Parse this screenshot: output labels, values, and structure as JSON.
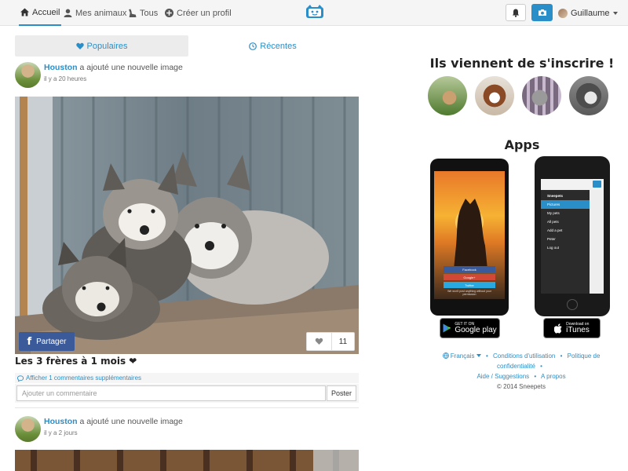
{
  "nav": {
    "items": [
      {
        "label": "Accueil",
        "icon": "home-icon",
        "active": true
      },
      {
        "label": "Mes animaux",
        "icon": "user-icon"
      },
      {
        "label": "Tous",
        "icon": "dog-icon"
      },
      {
        "label": "Créer un profil",
        "icon": "plus-circle-icon"
      }
    ],
    "user_name": "Guillaume"
  },
  "feed_tabs": [
    {
      "label": "Populaires",
      "icon": "heart-icon",
      "active": true
    },
    {
      "label": "Récentes",
      "icon": "clock-icon"
    }
  ],
  "posts": [
    {
      "author": "Houston",
      "action": " a ajouté une nouvelle image",
      "time": "il y a 20 heures",
      "share_label": "Partager",
      "like_count": "11",
      "caption": "Les 3 frères à 1 mois ❤",
      "more_comments": "Afficher 1 commentaires supplémentaires",
      "comment_placeholder": "Ajouter un commentaire",
      "comment_button": "Poster"
    },
    {
      "author": "Houston",
      "action": " a ajouté une nouvelle image",
      "time": "il y a 2 jours"
    }
  ],
  "sidebar": {
    "new_members_title": "Ils viennent de s'inscrire !",
    "apps_title": "Apps",
    "android_phone": {
      "buttons": [
        "Facebook",
        "Google+",
        "Twitter"
      ],
      "tagline": "We won't post anything without your permission"
    },
    "iphone_menu": [
      "Sneepets",
      "Pictures",
      "My pets",
      "All pets",
      "Add a pet",
      "Peter",
      "Log out"
    ],
    "google_play": {
      "top": "GET IT ON",
      "bottom": "Google play"
    },
    "itunes": {
      "top": "Download on",
      "bottom": "iTunes"
    }
  },
  "footer": {
    "language": "Français",
    "links": [
      "Conditions d'utilisation",
      "Politique de confidentialité",
      "Aide / Suggestions",
      "A propos"
    ],
    "copyright": "© 2014 Sneepets"
  },
  "colors": {
    "accent": "#2a8fc9",
    "facebook": "#3b5a9a"
  }
}
